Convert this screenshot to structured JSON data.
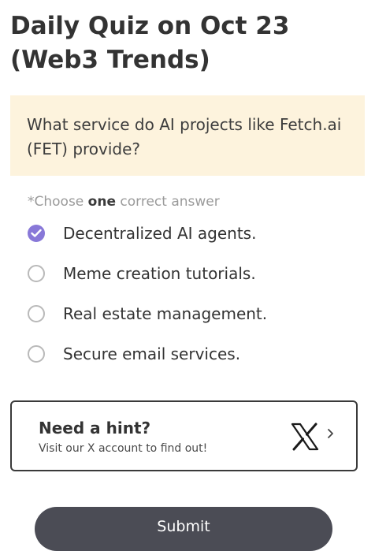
{
  "header": {
    "title": "Daily Quiz on Oct 23 (Web3 Trends)"
  },
  "question": {
    "text": "What service do AI projects like Fetch.ai (FET) provide?"
  },
  "instruction": {
    "prefix": "*Choose ",
    "emphasis": "one",
    "suffix": " correct answer"
  },
  "options": [
    {
      "label": "Decentralized AI agents.",
      "selected": true
    },
    {
      "label": "Meme creation tutorials.",
      "selected": false
    },
    {
      "label": "Real estate management.",
      "selected": false
    },
    {
      "label": "Secure email services.",
      "selected": false
    }
  ],
  "hint": {
    "title": "Need a hint?",
    "subtitle": "Visit our X account to find out!",
    "logo_icon": "x-logo-icon",
    "arrow_icon": "chevron-right-icon"
  },
  "submit": {
    "label": "Submit"
  },
  "colors": {
    "accent": "#8878d8",
    "question_bg": "#fdf3dd",
    "submit_bg": "#4b4c55"
  }
}
